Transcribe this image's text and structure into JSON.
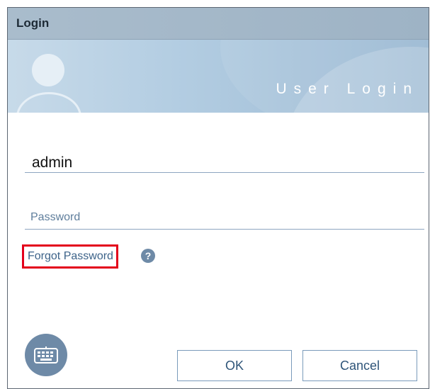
{
  "window": {
    "title": "Login"
  },
  "banner": {
    "title": "User Login",
    "avatar_icon": "user-avatar-icon",
    "lock_icon": "keyhole-icon"
  },
  "form": {
    "username_value": "admin",
    "password_placeholder": "Password",
    "forgot_password_label": "Forgot Password",
    "help_symbol": "?"
  },
  "actions": {
    "keyboard_icon": "keyboard-icon",
    "ok_label": "OK",
    "cancel_label": "Cancel"
  },
  "colors": {
    "titlebar": "#a9bccc",
    "banner": "#b3cde2",
    "link": "#3d6389",
    "highlight_border": "#e3001b",
    "icon_fill": "#6e8aa7"
  }
}
